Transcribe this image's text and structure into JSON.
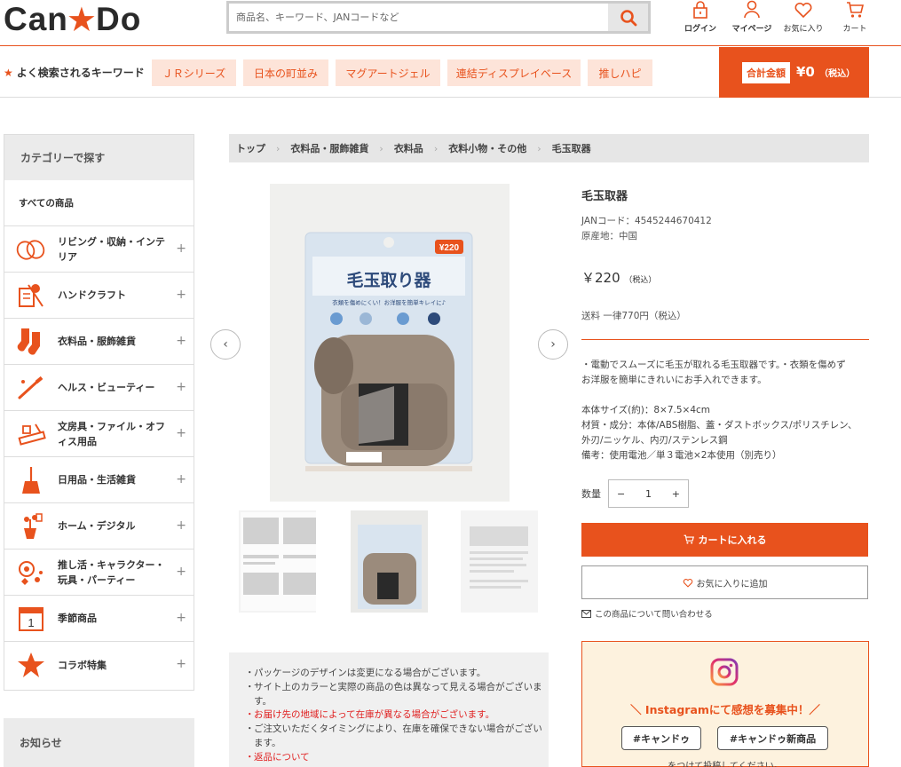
{
  "header": {
    "logo_left": "Can",
    "logo_right": "Do",
    "search_placeholder": "商品名、キーワード、JANコードなど",
    "icons": [
      {
        "label": "ログイン",
        "icon": "lock-icon"
      },
      {
        "label": "マイページ",
        "icon": "user-icon"
      },
      {
        "label": "お気に入り",
        "icon": "heart-icon"
      },
      {
        "label": "カート",
        "icon": "cart-icon"
      }
    ]
  },
  "keywords": {
    "title": "よく検索されるキーワード",
    "items": [
      "ＪＲシリーズ",
      "日本の町並み",
      "マグアートジェル",
      "連結ディスプレイベース",
      "推しハピ"
    ]
  },
  "total": {
    "label": "合計金額",
    "value": "¥0",
    "tax": "（税込）"
  },
  "sidebar": {
    "title": "カテゴリーで探す",
    "all": "すべての商品",
    "items": [
      {
        "label": "リビング・収納・インテリア",
        "icon": "living-icon"
      },
      {
        "label": "ハンドクラフト",
        "icon": "craft-icon"
      },
      {
        "label": "衣料品・服飾雑貨",
        "icon": "socks-icon"
      },
      {
        "label": "ヘルス・ビューティー",
        "icon": "beauty-icon"
      },
      {
        "label": "文房具・ファイル・オフィス用品",
        "icon": "stationery-icon"
      },
      {
        "label": "日用品・生活雑貨",
        "icon": "broom-icon"
      },
      {
        "label": "ホーム・デジタル",
        "icon": "home-digital-icon"
      },
      {
        "label": "推し活・キャラクター・玩具・パーティー",
        "icon": "party-icon"
      },
      {
        "label": "季節商品",
        "icon": "calendar-icon"
      },
      {
        "label": "コラボ特集",
        "icon": "star-icon"
      }
    ],
    "news": "お知らせ"
  },
  "breadcrumb": [
    "トップ",
    "衣料品・服飾雑貨",
    "衣料品",
    "衣料小物・その他",
    "毛玉取器"
  ],
  "product": {
    "name": "毛玉取器",
    "jan": "JANコード：4545244670412",
    "origin": "原産地：中国",
    "price": "￥220",
    "price_tax": "（税込）",
    "shipping": "送料 一律770円（税込）",
    "description": [
      "・電動でスムーズに毛玉が取れる毛玉取器です。・衣類を傷めず",
      "お洋服を簡単にきれいにお手入れできます。",
      "",
      "本体サイズ(約)：8×7.5×4cm",
      "材質・成分：本体/ABS樹脂、蓋・ダストボックス/ポリスチレン、",
      "外刃/ニッケル、内刃/ステンレス鋼",
      "備考：使用電池／単３電池×2本使用（別売り）"
    ],
    "quantity_label": "数量",
    "quantity": "1",
    "cart_button": "カートに入れる",
    "fav_button": "お気に入りに追加",
    "inquiry": "この商品について問い合わせる",
    "package_title": "毛玉取り器",
    "package_price": "¥220",
    "package_sub": "衣類を傷めにくい！お洋服を簡単キレイに♪"
  },
  "notes": [
    {
      "text": "パッケージのデザインは変更になる場合がございます。",
      "red": false
    },
    {
      "text": "サイト上のカラーと実際の商品の色は異なって見える場合がございます。",
      "red": false
    },
    {
      "text": "お届け先の地域によって在庫が異なる場合がございます。",
      "red": true
    },
    {
      "text": "ご注文いただくタイミングにより、在庫を確保できない場合がございます。",
      "red": false
    },
    {
      "text": "返品について",
      "red": true
    }
  ],
  "instagram": {
    "title": "＼ Instagramにて感想を募集中！／",
    "tags": [
      "#キャンドゥ",
      "#キャンドゥ新商品"
    ],
    "footer": "をつけて投稿してください。"
  },
  "colors": {
    "accent": "#e8521d",
    "keyword_bg": "#fde4d9",
    "insta_bg": "#fdf2de"
  }
}
